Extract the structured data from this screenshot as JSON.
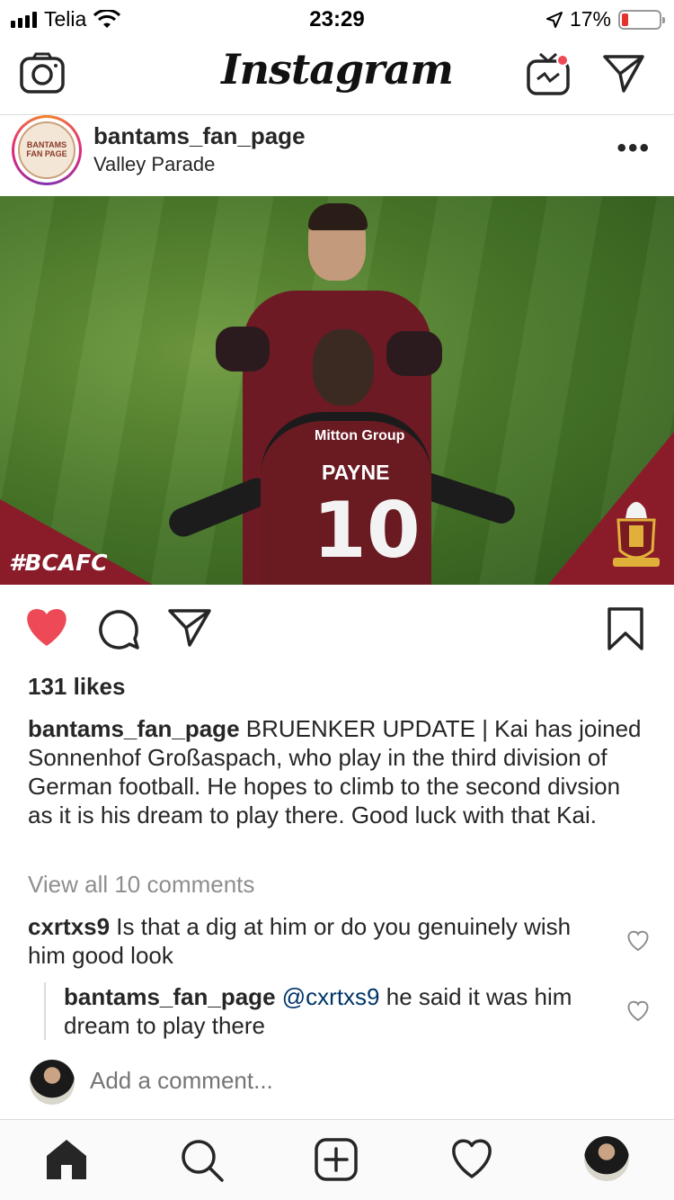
{
  "status_bar": {
    "carrier": "Telia",
    "time": "23:29",
    "battery_percent": "17%",
    "battery_level": 0.17
  },
  "header": {
    "app_title": "Instagram"
  },
  "post": {
    "username": "bantams_fan_page",
    "location": "Valley Parade",
    "avatar_text": "BANTAMS FAN PAGE",
    "image": {
      "hashtag": "#BCAFC",
      "sponsor": "Mitton Group",
      "shirt_name": "PAYNE",
      "shirt_number": "10"
    },
    "liked": true,
    "likes_text": "131 likes",
    "caption_user": "bantams_fan_page",
    "caption_text": " BRUENKER UPDATE | Kai has joined Sonnenhof Großaspach, who play in the third division of German football. He hopes to climb to the second divsion as it is his dream to play there. Good luck with that Kai.",
    "view_all_comments": "View all 10 comments",
    "comments": [
      {
        "user": "cxrtxs9",
        "text": " Is that a dig at him or do you genuinely wish him good look"
      }
    ],
    "reply": {
      "user": "bantams_fan_page",
      "mention": "@cxrtxs9",
      "text": " he said it was him dream to play there"
    },
    "add_comment_placeholder": "Add a comment..."
  },
  "icons": {
    "like": "heart-filled-icon",
    "comment": "comment-icon",
    "share": "paper-plane-icon",
    "save": "bookmark-icon"
  },
  "colors": {
    "like_red": "#ed4956",
    "mention_blue": "#003569",
    "muted_gray": "#8e8e8e",
    "banner_maroon": "#8a1c2a"
  }
}
